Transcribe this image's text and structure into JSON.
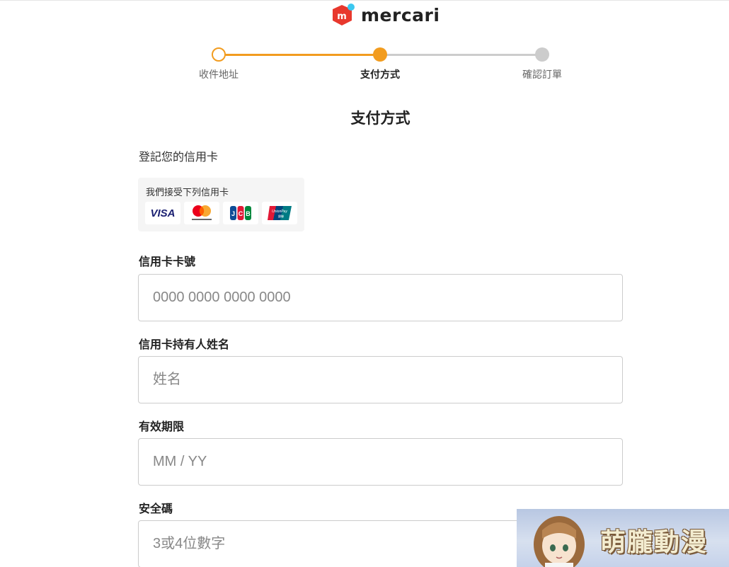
{
  "header": {
    "brand": "mercari",
    "logo_letter": "m"
  },
  "stepper": {
    "steps": [
      {
        "label": "收件地址",
        "state": "done"
      },
      {
        "label": "支付方式",
        "state": "current"
      },
      {
        "label": "確認訂單",
        "state": "todo"
      }
    ]
  },
  "page": {
    "title": "支付方式",
    "subtitle": "登記您的信用卡"
  },
  "accepted_cards": {
    "caption": "我們接受下列信用卡",
    "cards": [
      {
        "name": "VISA",
        "icon": "visa-icon"
      },
      {
        "name": "mastercard",
        "icon": "mastercard-icon"
      },
      {
        "name": "JCB",
        "icon": "jcb-icon"
      },
      {
        "name": "UnionPay 銀聯",
        "icon": "unionpay-icon"
      }
    ]
  },
  "form": {
    "card_number": {
      "label": "信用卡卡號",
      "placeholder": "0000 0000 0000 0000",
      "value": ""
    },
    "holder_name": {
      "label": "信用卡持有人姓名",
      "placeholder": "姓名",
      "value": ""
    },
    "expiry": {
      "label": "有效期限",
      "placeholder": "MM / YY",
      "value": ""
    },
    "cvc": {
      "label": "安全碼",
      "placeholder": "3或4位數字",
      "value": ""
    }
  },
  "watermark": {
    "text": "萌朧動漫"
  },
  "colors": {
    "accent": "#f29c1f",
    "inactive": "#cccccc",
    "brand_red": "#e8382d",
    "brand_blue": "#3cc8f0"
  }
}
